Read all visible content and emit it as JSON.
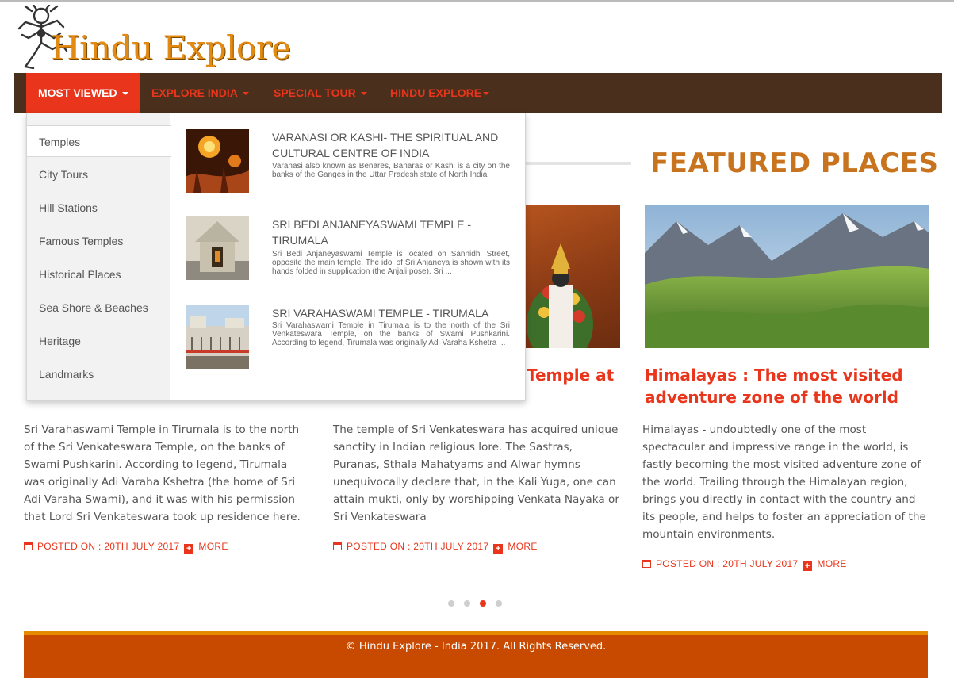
{
  "brand": {
    "name": "Hindu Explore",
    "logo_icon": "nataraja-dancer-icon"
  },
  "nav": {
    "items": [
      {
        "label": "MOST VIEWED",
        "active": true,
        "caret": true
      },
      {
        "label": "EXPLORE INDIA",
        "active": false,
        "caret": true
      },
      {
        "label": "SPECIAL TOUR",
        "active": false,
        "caret": true
      },
      {
        "label": "HINDU EXPLORE",
        "active": false,
        "caret": true
      }
    ]
  },
  "dropdown": {
    "categories": [
      "Temples",
      "City Tours",
      "Hill Stations",
      "Famous Temples",
      "Historical Places",
      "Sea Shore & Beaches",
      "Heritage",
      "Landmarks"
    ],
    "active_category": "Temples",
    "entries": [
      {
        "title": "VARANASI OR KASHI- THE SPIRITUAL AND CULTURAL CENTRE OF INDIA",
        "desc": "Varanasi also known as Benares, Banaras or Kashi is a city on the banks of the Ganges in the Uttar Pradesh state of North India",
        "thumb": "varanasi-ghats-image"
      },
      {
        "title": "SRI BEDI ANJANEYASWAMI TEMPLE - TIRUMALA",
        "desc": "Sri Bedi Anjaneyaswami Temple is located on Sannidhi Street, opposite the main temple. The idol of Sri Anjaneya is shown with its hands folded in supplication (the Anjali pose). Sri ...",
        "thumb": "anjaneya-shrine-image"
      },
      {
        "title": "SRI VARAHASWAMI TEMPLE - TIRUMALA",
        "desc": "Sri Varahaswami Temple in Tirumala is to the north of the Sri Venkateswara Temple, on the banks of Swami Pushkarini. According to legend, Tirumala was originally Adi Varaha Kshetra ...",
        "thumb": "varahaswami-temple-image"
      }
    ]
  },
  "featured": {
    "heading": "FEATURED PLACES",
    "cards": [
      {
        "title_visible": "",
        "text": "Sri Varahaswami Temple in Tirumala is to the north of the Sri Venkateswara Temple, on the banks of Swami Pushkarini. According to legend, Tirumala was originally Adi Varaha Kshetra (the home of Sri Adi Varaha Swami), and it was with his permission that Lord Sri Venkateswara took up residence here.",
        "posted": "POSTED ON : 20TH JULY 2017",
        "more": "MORE"
      },
      {
        "title_visible": "Temple at",
        "text": "The temple of Sri Venkateswara has acquired unique sanctity in Indian religious lore. The Sastras, Puranas, Sthala Mahatyams and Alwar hymns unequivocally declare that, in the Kali Yuga, one can attain mukti, only by worshipping Venkata Nayaka or Sri Venkateswara",
        "posted": "POSTED ON : 20TH JULY 2017",
        "more": "MORE"
      },
      {
        "title": "Himalayas : The most visited adventure zone of the world",
        "text": "Himalayas - undoubtedly one of the most spectacular and impressive range in the world, is fastly becoming the most visited adventure zone of the world. Trailing through the Himalayan region, brings you directly in contact with the country and its people, and helps to foster an appreciation of the mountain environments.",
        "posted": "POSTED ON : 20TH JULY 2017",
        "more": "MORE"
      }
    ]
  },
  "carousel": {
    "count": 4,
    "active_index": 2
  },
  "footer": {
    "text": "© Hindu Explore - India 2017. All Rights Reserved."
  },
  "colors": {
    "accent": "#e8351b",
    "nav_bg": "#4a2f1c",
    "heading": "#c8731e",
    "footer_bg": "#c84a00",
    "footer_border": "#e68a00"
  }
}
